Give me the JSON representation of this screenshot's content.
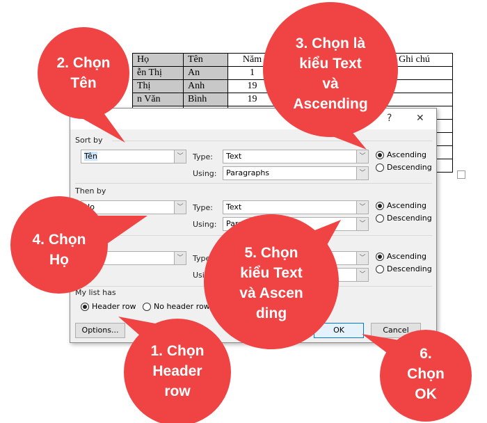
{
  "table": {
    "rows": [
      [
        "Họ",
        "Tên",
        "Năm",
        "",
        "Ghi chú"
      ],
      [
        "ễn Thị",
        "An",
        "1",
        "",
        ""
      ],
      [
        "Thị",
        "Anh",
        "19",
        "",
        ""
      ],
      [
        "n Văn",
        "Bình",
        "19",
        "",
        ""
      ],
      [
        "",
        "",
        "",
        "",
        ""
      ],
      [
        "",
        "",
        "",
        "",
        ""
      ],
      [
        "",
        "",
        "",
        "",
        ""
      ],
      [
        "",
        "",
        "",
        "",
        ""
      ],
      [
        "",
        "",
        "",
        "",
        ""
      ]
    ]
  },
  "dialog": {
    "help": "?",
    "close": "✕",
    "sort_by": {
      "label": "Sort by",
      "field": "Tên",
      "type_label": "Type:",
      "type": "Text",
      "using_label": "Using:",
      "using": "Paragraphs",
      "asc": "Ascending",
      "desc": "Descending",
      "selected": "Ascending"
    },
    "then_by": {
      "label": "Then by",
      "field": "Họ",
      "type_label": "Type:",
      "type": "Text",
      "using_label": "Using:",
      "using": "Paragraphs",
      "asc": "Ascending",
      "desc": "Descending",
      "selected": "Ascending"
    },
    "then_by2": {
      "field": "",
      "type_label": "Type:",
      "type": "",
      "using_label": "Using:",
      "using": "",
      "asc": "Ascending",
      "desc": "Descending",
      "selected": "Ascending"
    },
    "list_has": {
      "label": "My list has",
      "header": "Header row",
      "no_header": "No header row",
      "selected": "Header row"
    },
    "options": "Options...",
    "ok": "OK",
    "cancel": "Cancel"
  },
  "callouts": {
    "c1": "1. Chọn\nHeader\nrow",
    "c2": "2. Chọn\nTên",
    "c3": "3. Chọn là\nkiểu Text\nvà\nAscending",
    "c4": "4. Chọn\nHọ",
    "c5": "5. Chọn\nkiểu Text\nvà Ascen\nding",
    "c6": "6.\nChọn\nOK"
  },
  "colors": {
    "callout": "#f04444",
    "accent": "#0078d7"
  }
}
